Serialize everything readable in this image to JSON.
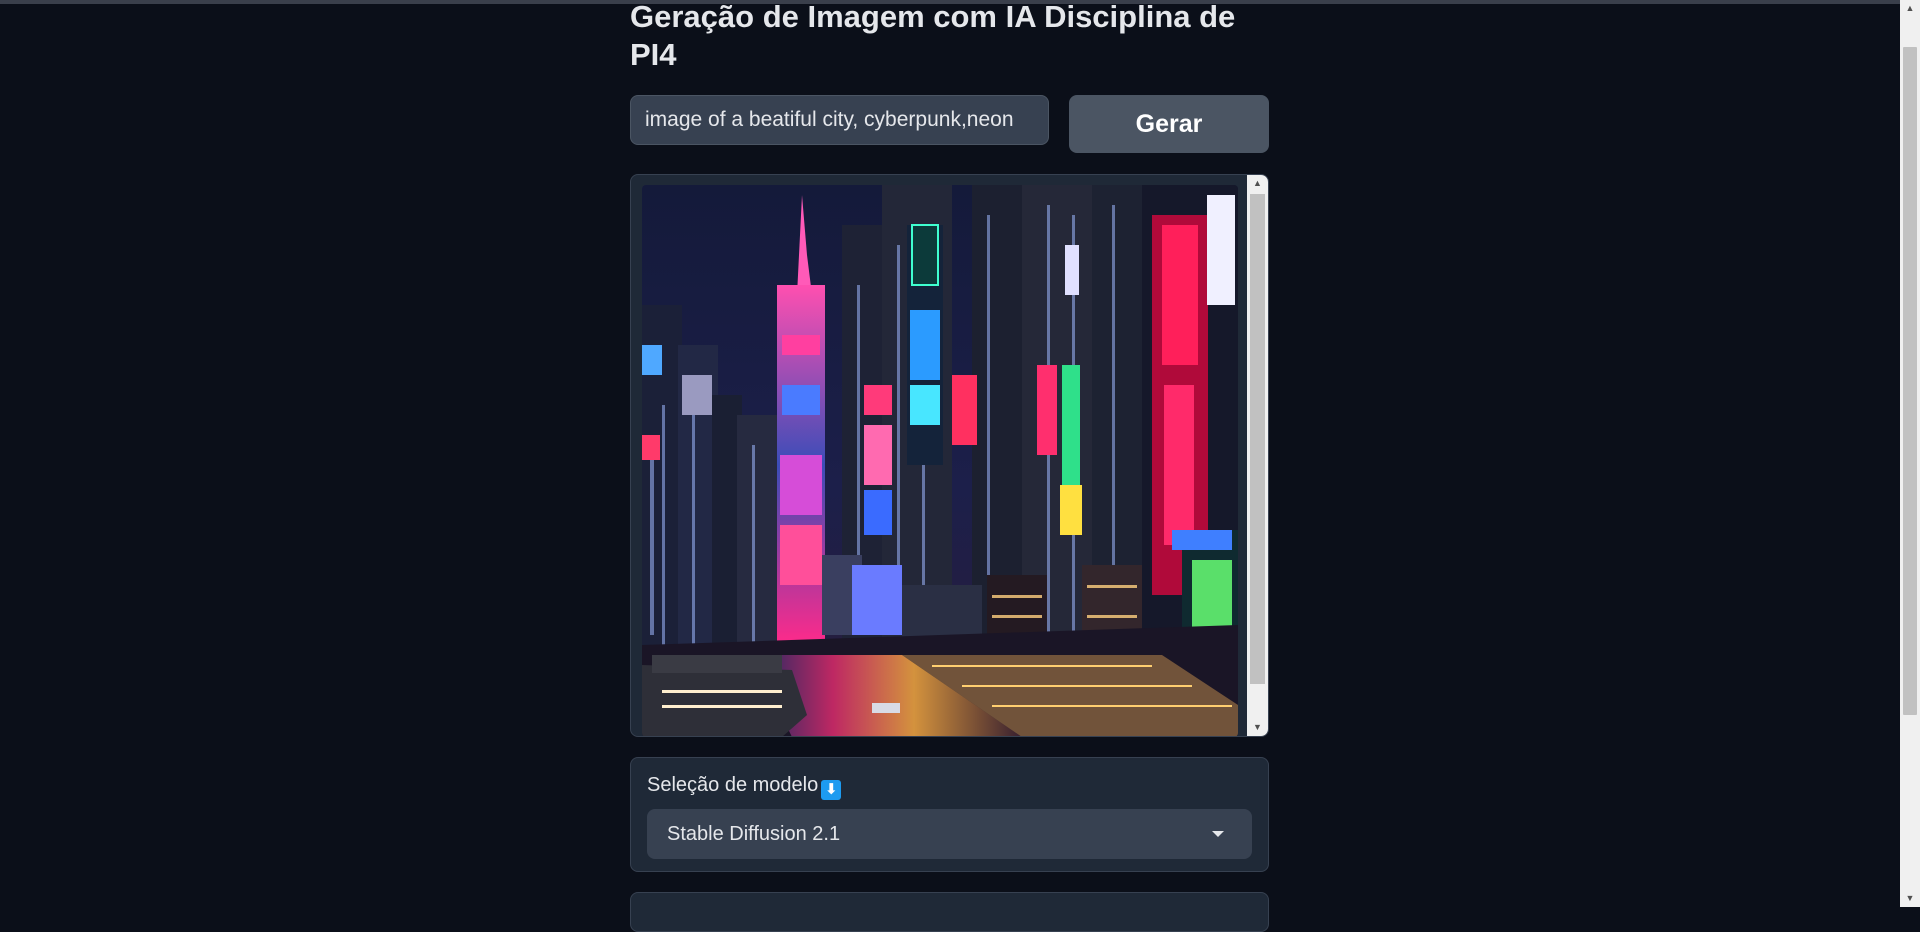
{
  "header": {
    "title": "Geração de Imagem com IA Disciplina de PI4"
  },
  "prompt": {
    "value": "image of a beatiful city, cyberpunk,neon",
    "placeholder": ""
  },
  "actions": {
    "generate_label": "Gerar"
  },
  "output_image": {
    "alt": "image of a beatiful city, cyberpunk,neon"
  },
  "model_selection": {
    "label": "Seleção de modelo",
    "icon": "down-arrow-emoji-icon",
    "icon_glyph": "⬇",
    "selected": "Stable Diffusion 2.1"
  },
  "colors": {
    "background": "#0b0f19",
    "panel": "#1f2937",
    "input": "#374151",
    "button": "#4b5563",
    "text": "#e5e7eb",
    "emoji_blue": "#1d9bf0"
  }
}
